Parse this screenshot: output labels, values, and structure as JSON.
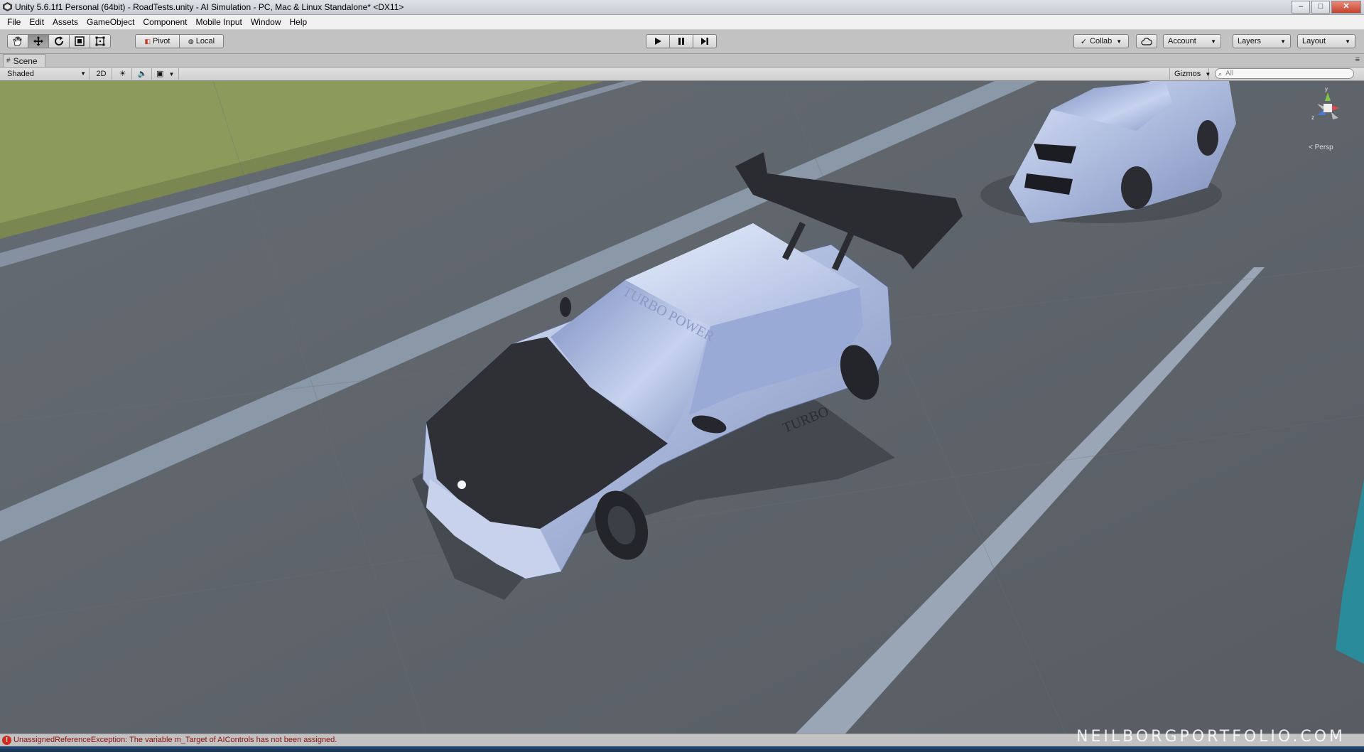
{
  "window": {
    "title": "Unity 5.6.1f1 Personal (64bit) - RoadTests.unity - AI Simulation - PC, Mac & Linux Standalone* <DX11>",
    "controls": [
      "minimize",
      "maximize",
      "close"
    ]
  },
  "menu": [
    "File",
    "Edit",
    "Assets",
    "GameObject",
    "Component",
    "Mobile Input",
    "Window",
    "Help"
  ],
  "toolbar": {
    "transform_tools": [
      {
        "name": "hand-tool",
        "icon": "hand-icon"
      },
      {
        "name": "move-tool",
        "icon": "move-arrows-icon",
        "active": true
      },
      {
        "name": "rotate-tool",
        "icon": "rotate-icon"
      },
      {
        "name": "scale-tool",
        "icon": "scale-icon"
      },
      {
        "name": "rect-tool",
        "icon": "rect-icon"
      }
    ],
    "pivot_label": "Pivot",
    "local_label": "Local",
    "play_controls": [
      "play",
      "pause",
      "step"
    ],
    "collab_label": "Collab",
    "account_label": "Account",
    "layers_label": "Layers",
    "layout_label": "Layout"
  },
  "scene": {
    "tab_label": "Scene",
    "shading_mode": "Shaded",
    "mode_2d_label": "2D",
    "gizmos_label": "Gizmos",
    "search_placeholder": "All",
    "projection_label": "Persp",
    "car_decals": [
      "TURBO POWER",
      "TURBO"
    ]
  },
  "status": {
    "message": "UnassignedReferenceException: The variable m_Target of AIControls has not been assigned.",
    "level": "error"
  },
  "watermark": "NEILBORGPORTFOLIO.COM",
  "colors": {
    "editor_gray": "#c2c2c2",
    "road": "#5c6268",
    "lane_marking": "#8e9aa8",
    "grass": "#8a9a5a",
    "car_body": "#b8c4e4",
    "car_hood": "#2f3036",
    "error_red": "#d02a1e"
  }
}
